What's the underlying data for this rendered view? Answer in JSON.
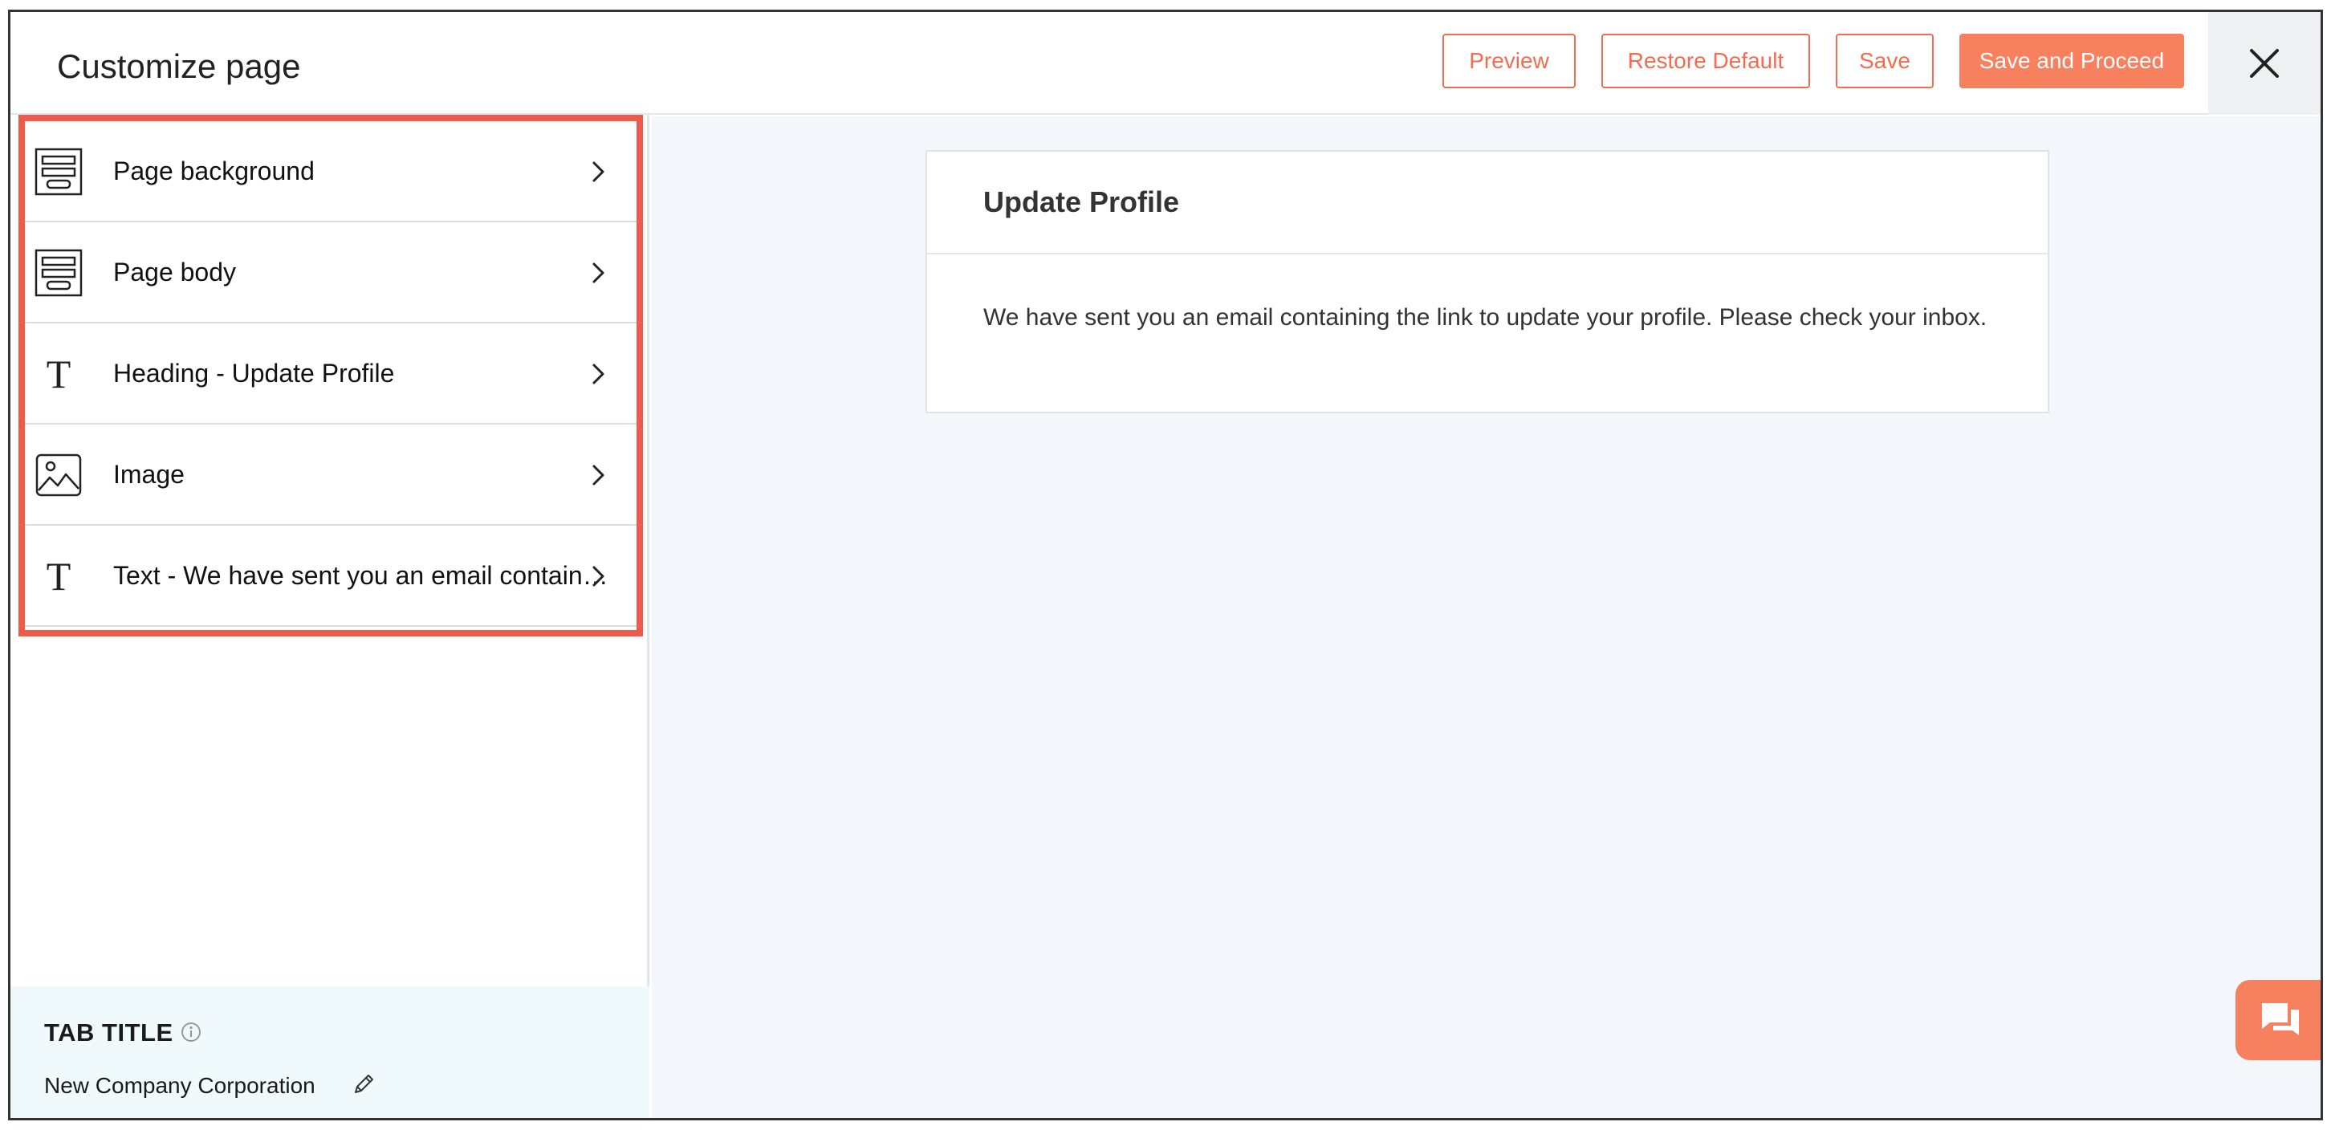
{
  "header": {
    "title": "Customize page",
    "buttons": {
      "preview": "Preview",
      "restore": "Restore Default",
      "save": "Save",
      "save_proceed": "Save and Proceed"
    }
  },
  "sidebar": {
    "items": [
      {
        "label": "Page background",
        "icon": "layout-icon"
      },
      {
        "label": "Page body",
        "icon": "layout-icon"
      },
      {
        "label": "Heading - Update Profile",
        "icon": "text-icon"
      },
      {
        "label": "Image",
        "icon": "image-icon"
      },
      {
        "label": "Text - We have sent you an email containing the link to update your profile. Please check your inbox.",
        "icon": "text-icon"
      }
    ],
    "tab_title": {
      "label": "TAB TITLE",
      "value": "New Company Corporation"
    }
  },
  "preview": {
    "heading": "Update Profile",
    "body": "We have sent you an email containing the link to update your profile. Please check your inbox."
  },
  "colors": {
    "accent": "#f26d4f",
    "highlight_border": "#f05a4a",
    "canvas_bg": "#f3f6fa"
  }
}
